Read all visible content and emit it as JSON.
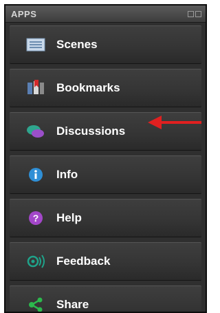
{
  "panel": {
    "title": "APPS",
    "items": [
      {
        "label": "Scenes",
        "icon": "scenes-icon"
      },
      {
        "label": "Bookmarks",
        "icon": "bookmarks-icon"
      },
      {
        "label": "Discussions",
        "icon": "discussions-icon"
      },
      {
        "label": "Info",
        "icon": "info-icon"
      },
      {
        "label": "Help",
        "icon": "help-icon"
      },
      {
        "label": "Feedback",
        "icon": "feedback-icon"
      },
      {
        "label": "Share",
        "icon": "share-icon"
      }
    ]
  },
  "colors": {
    "panel_bg": "#2f2f2f",
    "label": "#ffffff",
    "annotation_arrow": "#e02020"
  }
}
